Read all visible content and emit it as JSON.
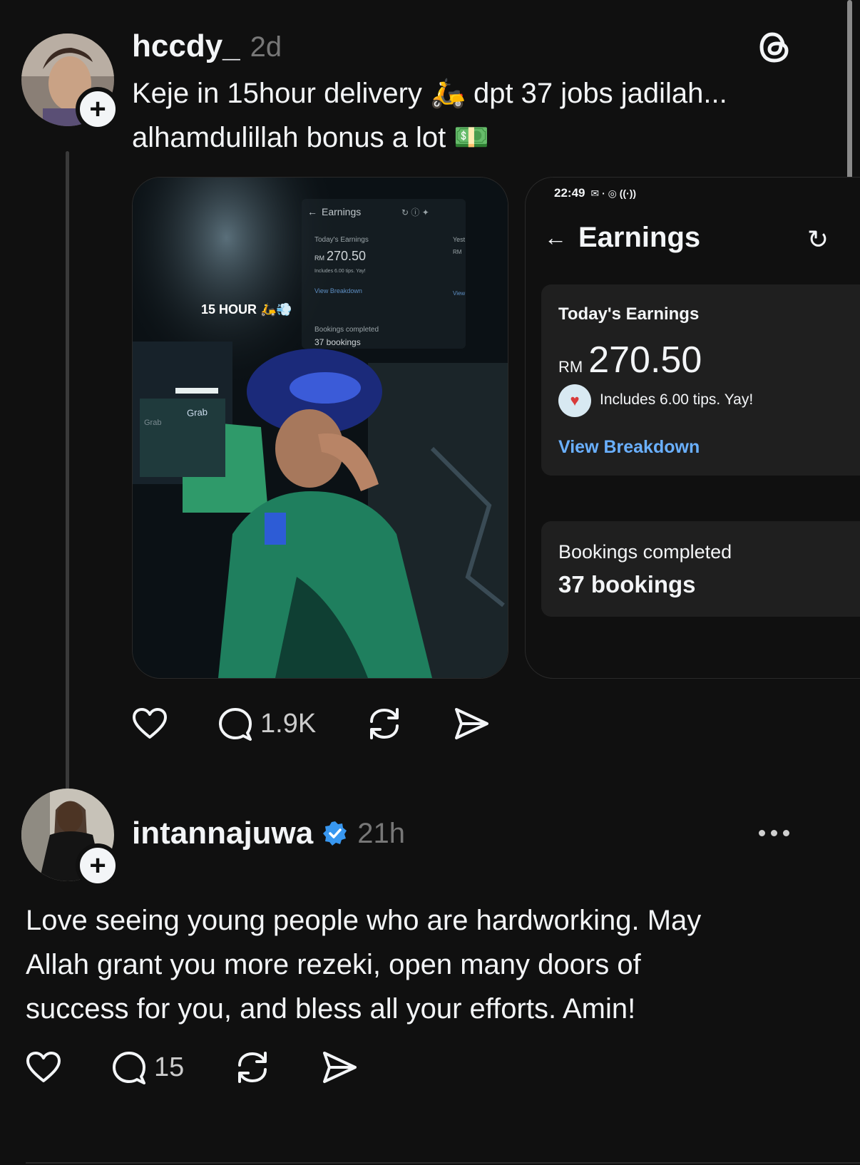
{
  "post1": {
    "username": "hccdy_",
    "time": "2d",
    "text_line1": "Keje in 15hour delivery 🛵 dpt 37 jobs jadilah...",
    "text_line2": "alhamdulillah bonus a lot 💵",
    "media1": {
      "overlay_text": "15 HOUR 🛵💨",
      "mini_screen": {
        "title": "Earnings",
        "today_label": "Today's Earnings",
        "currency": "RM",
        "amount": "270.50",
        "tips_note": "Includes 6.00 tips. Yay!",
        "view_breakdown": "View Breakdown",
        "bookings_label": "Bookings completed",
        "bookings_value": "37 bookings",
        "side_label": "Yest",
        "side_currency": "RM",
        "side_link": "View"
      },
      "bag_brand": "Grab",
      "bag_brand_side": "Grab"
    },
    "media2": {
      "status_time": "22:49",
      "title": "Earnings",
      "today_label": "Today's Earnings",
      "currency": "RM",
      "amount": "270.50",
      "tips_note": "Includes 6.00 tips. Yay!",
      "view_breakdown": "View Breakdown",
      "bookings_label": "Bookings completed",
      "bookings_value": "37 bookings"
    },
    "actions": {
      "replies": "1.9K"
    }
  },
  "post2": {
    "username": "intannajuwa",
    "verified": true,
    "time": "21h",
    "text_line1": "Love seeing young people who are hardworking. May",
    "text_line2": "Allah grant you more rezeki, open many doors of",
    "text_line3": "success for you, and bless all your efforts. Amin!",
    "actions": {
      "replies": "15"
    }
  },
  "icons": {
    "app_logo": "threads-logo-icon",
    "like": "heart-icon",
    "reply": "comment-icon",
    "repost": "repost-icon",
    "share": "send-icon",
    "more": "more-icon",
    "verified": "verified-badge-icon",
    "follow": "plus-icon"
  },
  "colors": {
    "background": "#101010",
    "text": "#f3f5f7",
    "muted": "#777777",
    "verified": "#3897f0",
    "link": "#6ab0ff"
  }
}
